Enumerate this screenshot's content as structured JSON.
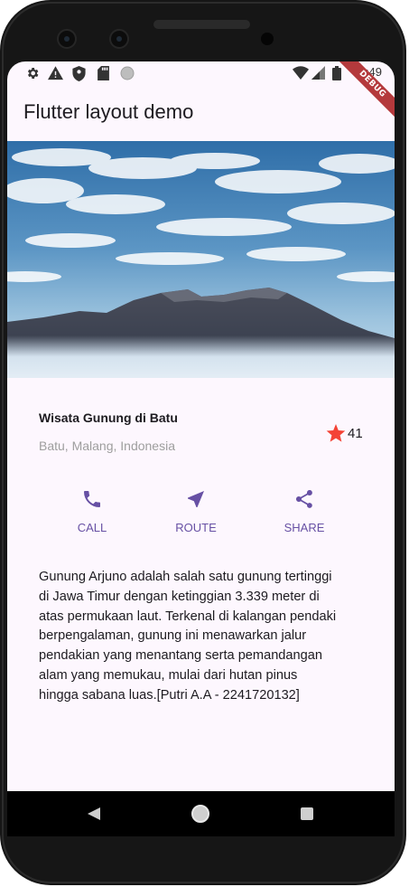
{
  "status_bar": {
    "time": "3:49",
    "debug_banner": "DEBUG",
    "left_icons": [
      "settings-icon",
      "warning-icon",
      "shield-icon",
      "sd-card-icon",
      "circle-icon"
    ],
    "right_icons": [
      "wifi-icon",
      "signal-icon",
      "battery-icon"
    ]
  },
  "app_bar": {
    "title": "Flutter layout demo"
  },
  "hero_image": {
    "description": "mountain-landscape"
  },
  "place": {
    "name": "Wisata Gunung di Batu",
    "location": "Batu, Malang, Indonesia",
    "rating_count": "41",
    "star_color": "#f44336"
  },
  "actions": [
    {
      "label": "CALL",
      "icon": "phone-icon"
    },
    {
      "label": "ROUTE",
      "icon": "navigation-icon"
    },
    {
      "label": "SHARE",
      "icon": "share-icon"
    }
  ],
  "description_lines": [
    "Gunung Arjuno adalah salah satu gunung tertinggi",
    "di Jawa Timur dengan ketinggian 3.339 meter di",
    "atas permukaan laut. Terkenal di kalangan pendaki",
    "berpengalaman, gunung ini menawarkan jalur",
    "pendakian yang menantang serta pemandangan",
    "alam yang memukau, mulai dari hutan pinus",
    "hingga sabana luas.[Putri A.A - 2241720132]"
  ],
  "colors": {
    "accent": "#6750a4",
    "background": "#fdf7fe"
  },
  "nav_bar": {
    "buttons": [
      "back-icon",
      "home-icon",
      "recents-icon"
    ]
  }
}
